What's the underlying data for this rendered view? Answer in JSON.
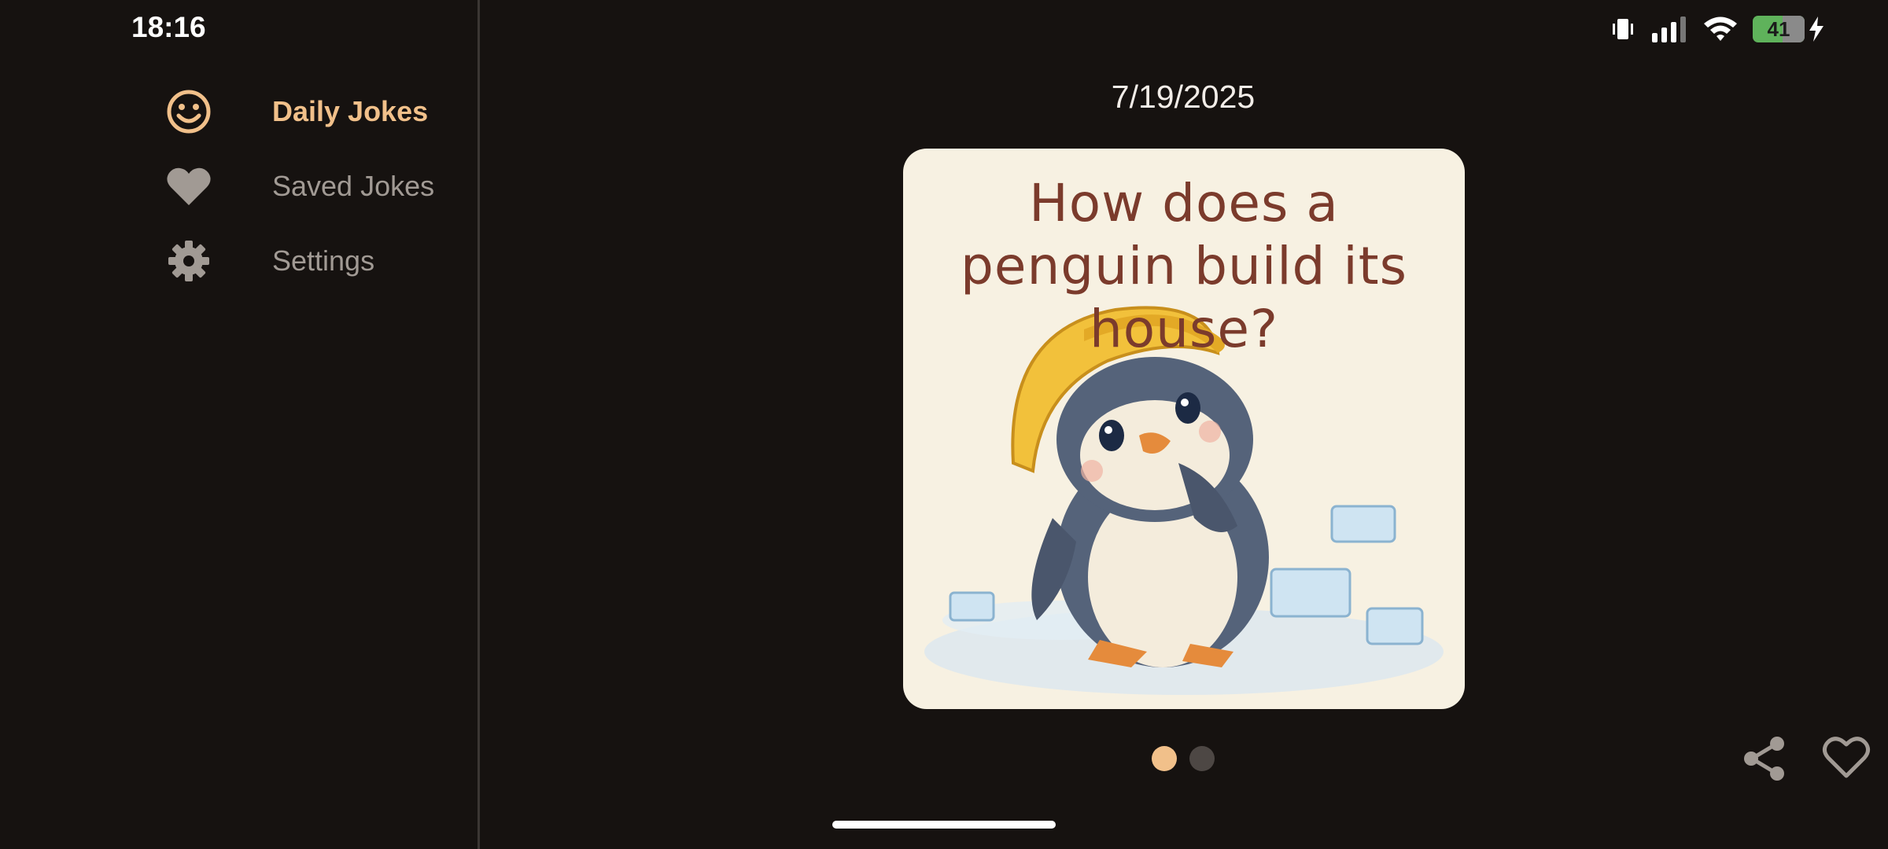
{
  "status_bar": {
    "time": "18:16",
    "battery_percent": "41",
    "icons": [
      "vibrate-icon",
      "signal-icon",
      "wifi-icon",
      "battery-icon",
      "charging-icon"
    ]
  },
  "nav": {
    "items": [
      {
        "label": "Daily Jokes",
        "icon": "smiley-icon",
        "active": true
      },
      {
        "label": "Saved Jokes",
        "icon": "heart-icon",
        "active": false
      },
      {
        "label": "Settings",
        "icon": "gear-icon",
        "active": false
      }
    ]
  },
  "joke": {
    "date": "7/19/2025",
    "question": "How does a penguin build its house?",
    "page_count": 2,
    "current_page": 1
  },
  "actions": {
    "share_icon": "share-icon",
    "favorite_icon": "heart-outline-icon"
  },
  "colors": {
    "background": "#161210",
    "accent": "#f1c08a",
    "inactive": "#a19a94",
    "card": "#f7f1e2",
    "card_text": "#7b3b2c"
  }
}
